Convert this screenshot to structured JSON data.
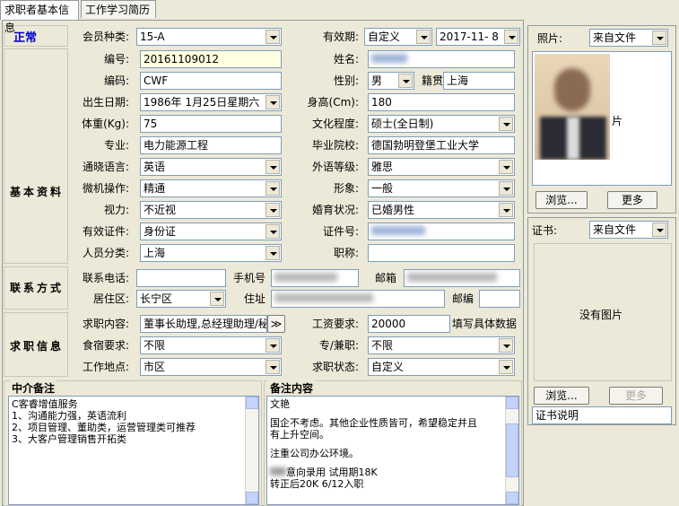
{
  "tabs": [
    {
      "label": "求职者基本信息"
    },
    {
      "label": "工作学习简历"
    }
  ],
  "status": {
    "label": "正常",
    "color": "#0000cc"
  },
  "membership": {
    "label": "会员种类:",
    "value": "15-A"
  },
  "validity": {
    "label": "有效期:",
    "mode": "自定义",
    "date": "2017-11- 8"
  },
  "sections": {
    "basic": "基本资料",
    "contact": "联系方式",
    "job": "求职信息"
  },
  "basic": {
    "id_label": "编号:",
    "id_value": "20161109012",
    "name_label": "姓名:",
    "name_value": "",
    "code_label": "编码:",
    "code_value": "CWF",
    "gender_label": "性别:",
    "gender_value": "男",
    "native_label": "籍贯",
    "native_value": "上海",
    "birth_label": "出生日期:",
    "birth_value": "1986年 1月25日星期六",
    "height_label": "身高(Cm):",
    "height_value": "180",
    "weight_label": "体重(Kg):",
    "weight_value": "75",
    "edu_label": "文化程度:",
    "edu_value": "硕士(全日制)",
    "major_label": "专业:",
    "major_value": "电力能源工程",
    "school_label": "毕业院校:",
    "school_value": "德国勃明登堡工业大学",
    "lang_label": "通晓语言:",
    "lang_value": "英语",
    "lang_level_label": "外语等级:",
    "lang_level_value": "雅思",
    "pc_label": "微机操作:",
    "pc_value": "精通",
    "image_label": "形象:",
    "image_value": "一般",
    "vision_label": "视力:",
    "vision_value": "不近视",
    "marital_label": "婚育状况:",
    "marital_value": "已婚男性",
    "cert_label": "有效证件:",
    "cert_value": "身份证",
    "certno_label": "证件号:",
    "certno_value": "",
    "category_label": "人员分类:",
    "category_value": "上海",
    "title_label": "职称:",
    "title_value": ""
  },
  "contact": {
    "phone_label": "联系电话:",
    "phone_value": "",
    "mobile_label": "手机号",
    "mobile_value": "",
    "email_label": "邮箱",
    "email_value": "",
    "district_label": "居住区:",
    "district_value": "长宁区",
    "address_label": "住址",
    "address_value": "",
    "zip_label": "邮编",
    "zip_value": ""
  },
  "job": {
    "content_label": "求职内容:",
    "content_value": "董事长助理,总经理助理/秘",
    "more_label": "≫",
    "salary_label": "工资要求:",
    "salary_value": "20000",
    "salary_hint": "填写具体数据",
    "board_label": "食宿要求:",
    "board_value": "不限",
    "parttime_label": "专/兼职:",
    "parttime_value": "不限",
    "location_label": "工作地点:",
    "location_value": "市区",
    "state_label": "求职状态:",
    "state_value": "自定义"
  },
  "notes": {
    "agent_title": "中介备注",
    "agent_text": [
      "C客睿增值服务",
      "1、沟通能力强，英语流利",
      "2、项目管理、董助类，运营管理类可推荐",
      "3、大客户管理销售开拓类"
    ],
    "remark_title": "备注内容",
    "remark_text": [
      "文艳",
      "",
      "国企不考虑。其他企业性质皆可，希望稳定并且",
      "有上升空间。",
      "",
      "注重公司办公环境。",
      "",
      "意向录用  试用期18K",
      "转正后20K   6/12入职"
    ]
  },
  "photo": {
    "label": "照片:",
    "source": "来自文件",
    "caption": "片",
    "browse": "浏览...",
    "more": "更多"
  },
  "certificate": {
    "label": "证书:",
    "source": "来自文件",
    "empty": "没有图片",
    "browse": "浏览...",
    "more": "更多",
    "desc": "证书说明"
  }
}
